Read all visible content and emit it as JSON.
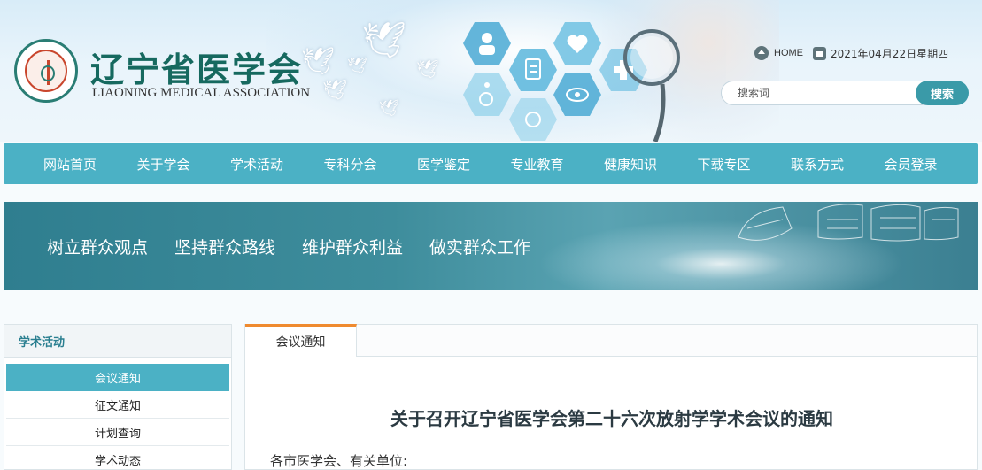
{
  "header": {
    "org_name_cn": "辽宁省医学会",
    "org_name_en": "LIAONING MEDICAL ASSOCIATION",
    "home_label": "HOME",
    "date": "2021年04月22日星期四",
    "search_placeholder": "搜索词",
    "search_button": "搜索"
  },
  "nav": {
    "items": [
      "网站首页",
      "关于学会",
      "学术活动",
      "专科分会",
      "医学鉴定",
      "专业教育",
      "健康知识",
      "下载专区",
      "联系方式",
      "会员登录"
    ]
  },
  "banner": {
    "slogans": [
      "树立群众观点",
      "坚持群众路线",
      "维护群众利益",
      "做实群众工作"
    ]
  },
  "sidebar": {
    "title": "学术活动",
    "items": [
      "会议通知",
      "征文通知",
      "计划查询",
      "学术动态"
    ],
    "active_index": 0
  },
  "main": {
    "tab": "会议通知",
    "article_title": "关于召开辽宁省医学会第二十六次放射学学术会议的通知",
    "greeting": "各市医学会、有关单位:"
  },
  "colors": {
    "accent": "#4bb1c5",
    "brand_green": "#16695f",
    "tab_highlight": "#ef8a2f",
    "search_button": "#3a9aa8"
  },
  "icons": {
    "home": "home-icon",
    "date": "calendar-icon"
  }
}
